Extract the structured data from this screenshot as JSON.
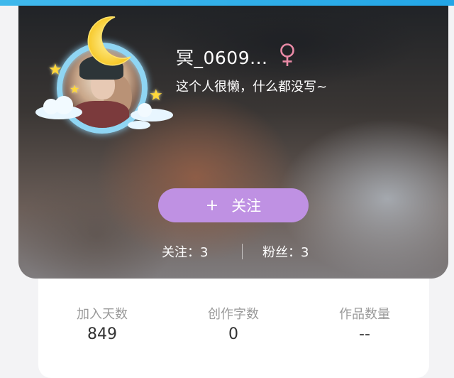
{
  "profile": {
    "username": "冥_0609...",
    "gender_icon": "female-symbol-icon",
    "gender_color": "#e98aa6",
    "bio": "这个人很懒，什么都没写~",
    "avatar_decoration": "moon-stars-clouds-frame"
  },
  "follow_button": {
    "plus_icon": "+",
    "label": "关注",
    "color": "#bf91e3"
  },
  "social": {
    "following": "关注：3",
    "fans": "粉丝：3"
  },
  "stats": [
    {
      "label": "加入天数",
      "value": "849"
    },
    {
      "label": "创作字数",
      "value": "0"
    },
    {
      "label": "作品数量",
      "value": "--"
    }
  ],
  "colors": {
    "accent_strip": "#23a6e6",
    "panel_bg": "#ffffff",
    "page_bg": "#f3f3f5"
  }
}
